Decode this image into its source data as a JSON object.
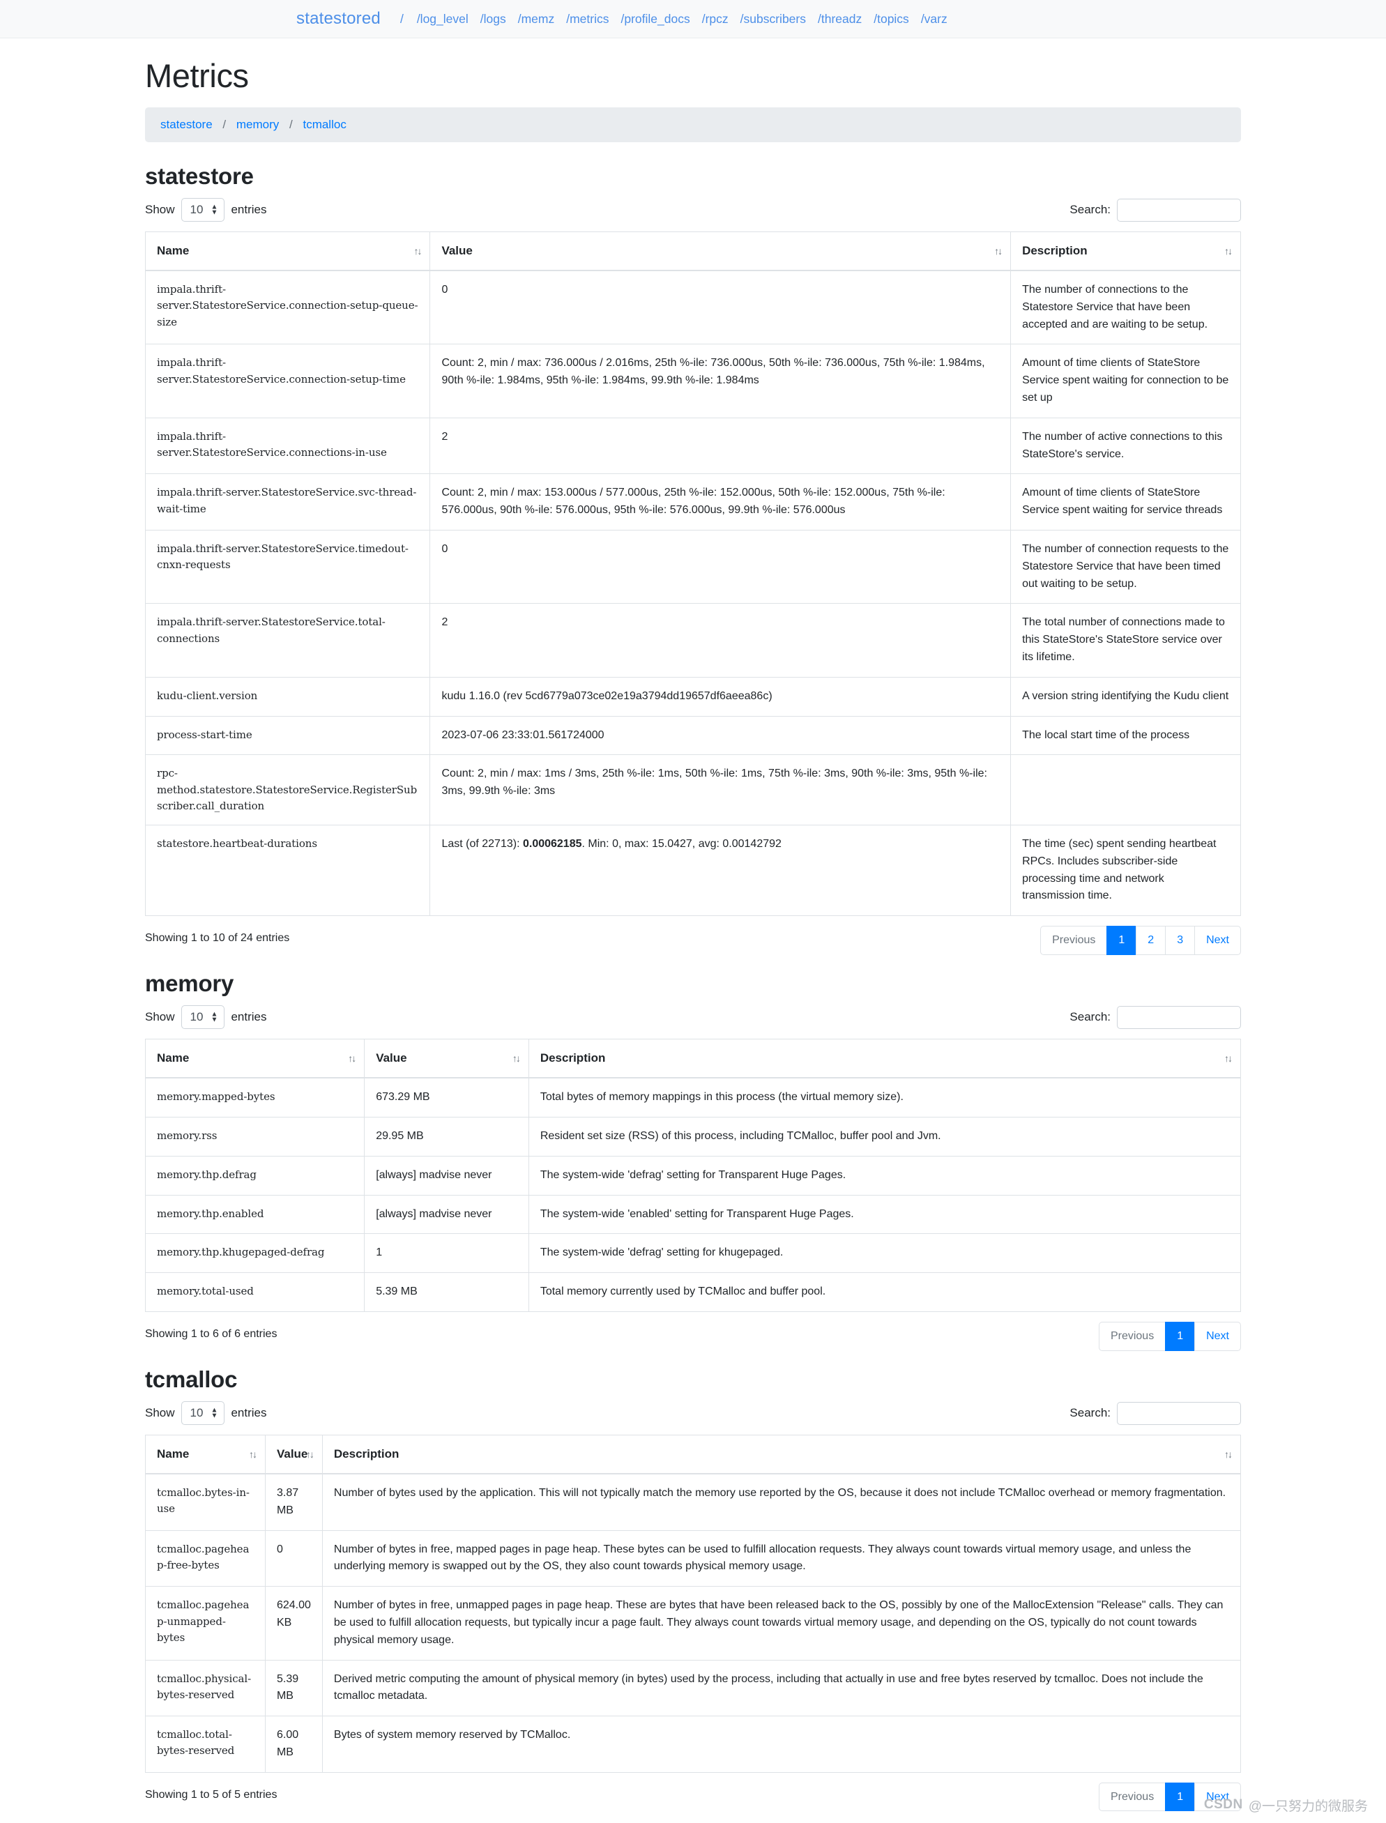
{
  "navbar": {
    "brand": "statestored",
    "links": [
      "/",
      "/log_level",
      "/logs",
      "/memz",
      "/metrics",
      "/profile_docs",
      "/rpcz",
      "/subscribers",
      "/threadz",
      "/topics",
      "/varz"
    ]
  },
  "page": {
    "title": "Metrics",
    "breadcrumb": [
      "statestore",
      "memory",
      "tcmalloc"
    ],
    "breadcrumb_separator": "/"
  },
  "controls": {
    "show_label": "Show",
    "entries_label": "entries",
    "page_size": "10",
    "search_label": "Search:",
    "search_value": "",
    "search_placeholder": ""
  },
  "table_headers": {
    "name": "Name",
    "value": "Value",
    "description": "Description",
    "sort_icon": "↑↓"
  },
  "pagination_labels": {
    "previous": "Previous",
    "next": "Next"
  },
  "sections": [
    {
      "id": "statestore",
      "title": "statestore",
      "info": "Showing 1 to 10 of 24 entries",
      "pages": [
        "1",
        "2",
        "3"
      ],
      "active_page": "1",
      "rows": [
        {
          "name": "impala.thrift-server.StatestoreService.connection-setup-queue-size",
          "value": "0",
          "description": "The number of connections to the Statestore Service that have been accepted and are waiting to be setup."
        },
        {
          "name": "impala.thrift-server.StatestoreService.connection-setup-time",
          "value": "Count: 2, min / max: 736.000us / 2.016ms, 25th %-ile: 736.000us, 50th %-ile: 736.000us, 75th %-ile: 1.984ms, 90th %-ile: 1.984ms, 95th %-ile: 1.984ms, 99.9th %-ile: 1.984ms",
          "description": "Amount of time clients of StateStore Service spent waiting for connection to be set up"
        },
        {
          "name": "impala.thrift-server.StatestoreService.connections-in-use",
          "value": "2",
          "description": "The number of active connections to this StateStore's service."
        },
        {
          "name": "impala.thrift-server.StatestoreService.svc-thread-wait-time",
          "value": "Count: 2, min / max: 153.000us / 577.000us, 25th %-ile: 152.000us, 50th %-ile: 152.000us, 75th %-ile: 576.000us, 90th %-ile: 576.000us, 95th %-ile: 576.000us, 99.9th %-ile: 576.000us",
          "description": "Amount of time clients of StateStore Service spent waiting for service threads"
        },
        {
          "name": "impala.thrift-server.StatestoreService.timedout-cnxn-requests",
          "value": "0",
          "description": "The number of connection requests to the Statestore Service that have been timed out waiting to be setup."
        },
        {
          "name": "impala.thrift-server.StatestoreService.total-connections",
          "value": "2",
          "description": "The total number of connections made to this StateStore's StateStore service over its lifetime."
        },
        {
          "name": "kudu-client.version",
          "value": "kudu 1.16.0 (rev 5cd6779a073ce02e19a3794dd19657df6aeea86c)",
          "description": "A version string identifying the Kudu client"
        },
        {
          "name": "process-start-time",
          "value": "2023-07-06 23:33:01.561724000",
          "description": "The local start time of the process"
        },
        {
          "name": "rpc-method.statestore.StatestoreService.RegisterSubscriber.call_duration",
          "value": "Count: 2, min / max: 1ms / 3ms, 25th %-ile: 1ms, 50th %-ile: 1ms, 75th %-ile: 3ms, 90th %-ile: 3ms, 95th %-ile: 3ms, 99.9th %-ile: 3ms",
          "description": ""
        },
        {
          "name": "statestore.heartbeat-durations",
          "value_prefix": "Last (of 22713): ",
          "value_bold": "0.00062185",
          "value_suffix": ". Min: 0, max: 15.0427, avg: 0.00142792",
          "value": "Last (of 22713): 0.00062185. Min: 0, max: 15.0427, avg: 0.00142792",
          "description": "The time (sec) spent sending heartbeat RPCs. Includes subscriber-side processing time and network transmission time."
        }
      ]
    },
    {
      "id": "memory",
      "title": "memory",
      "info": "Showing 1 to 6 of 6 entries",
      "pages": [
        "1"
      ],
      "active_page": "1",
      "rows": [
        {
          "name": "memory.mapped-bytes",
          "value": "673.29 MB",
          "description": "Total bytes of memory mappings in this process (the virtual memory size)."
        },
        {
          "name": "memory.rss",
          "value": "29.95 MB",
          "description": "Resident set size (RSS) of this process, including TCMalloc, buffer pool and Jvm."
        },
        {
          "name": "memory.thp.defrag",
          "value": "[always] madvise never",
          "description": "The system-wide 'defrag' setting for Transparent Huge Pages."
        },
        {
          "name": "memory.thp.enabled",
          "value": "[always] madvise never",
          "description": "The system-wide 'enabled' setting for Transparent Huge Pages."
        },
        {
          "name": "memory.thp.khugepaged-defrag",
          "value": "1",
          "description": "The system-wide 'defrag' setting for khugepaged."
        },
        {
          "name": "memory.total-used",
          "value": "5.39 MB",
          "description": "Total memory currently used by TCMalloc and buffer pool."
        }
      ]
    },
    {
      "id": "tcmalloc",
      "title": "tcmalloc",
      "info": "Showing 1 to 5 of 5 entries",
      "pages": [
        "1"
      ],
      "active_page": "1",
      "rows": [
        {
          "name": "tcmalloc.bytes-in-use",
          "value": "3.87 MB",
          "description": "Number of bytes used by the application. This will not typically match the memory use reported by the OS, because it does not include TCMalloc overhead or memory fragmentation."
        },
        {
          "name": "tcmalloc.pageheap-free-bytes",
          "value": "0",
          "description": "Number of bytes in free, mapped pages in page heap. These bytes can be used to fulfill allocation requests. They always count towards virtual memory usage, and unless the underlying memory is swapped out by the OS, they also count towards physical memory usage."
        },
        {
          "name": "tcmalloc.pageheap-unmapped-bytes",
          "value": "624.00 KB",
          "description": "Number of bytes in free, unmapped pages in page heap. These are bytes that have been released back to the OS, possibly by one of the MallocExtension \"Release\" calls. They can be used to fulfill allocation requests, but typically incur a page fault. They always count towards virtual memory usage, and depending on the OS, typically do not count towards physical memory usage."
        },
        {
          "name": "tcmalloc.physical-bytes-reserved",
          "value": "5.39 MB",
          "description": "Derived metric computing the amount of physical memory (in bytes) used by the process, including that actually in use and free bytes reserved by tcmalloc. Does not include the tcmalloc metadata."
        },
        {
          "name": "tcmalloc.total-bytes-reserved",
          "value": "6.00 MB",
          "description": "Bytes of system memory reserved by TCMalloc."
        }
      ]
    }
  ],
  "watermark": {
    "brand": "CSDN",
    "text": "@一只努力的微服务"
  },
  "colors": {
    "link": "#007bff",
    "nav_link": "#4d8fe8",
    "active_page_bg": "#007bff",
    "breadcrumb_bg": "#e9ecef",
    "navbar_bg": "#f8f9fa",
    "border": "#dee2e6"
  }
}
